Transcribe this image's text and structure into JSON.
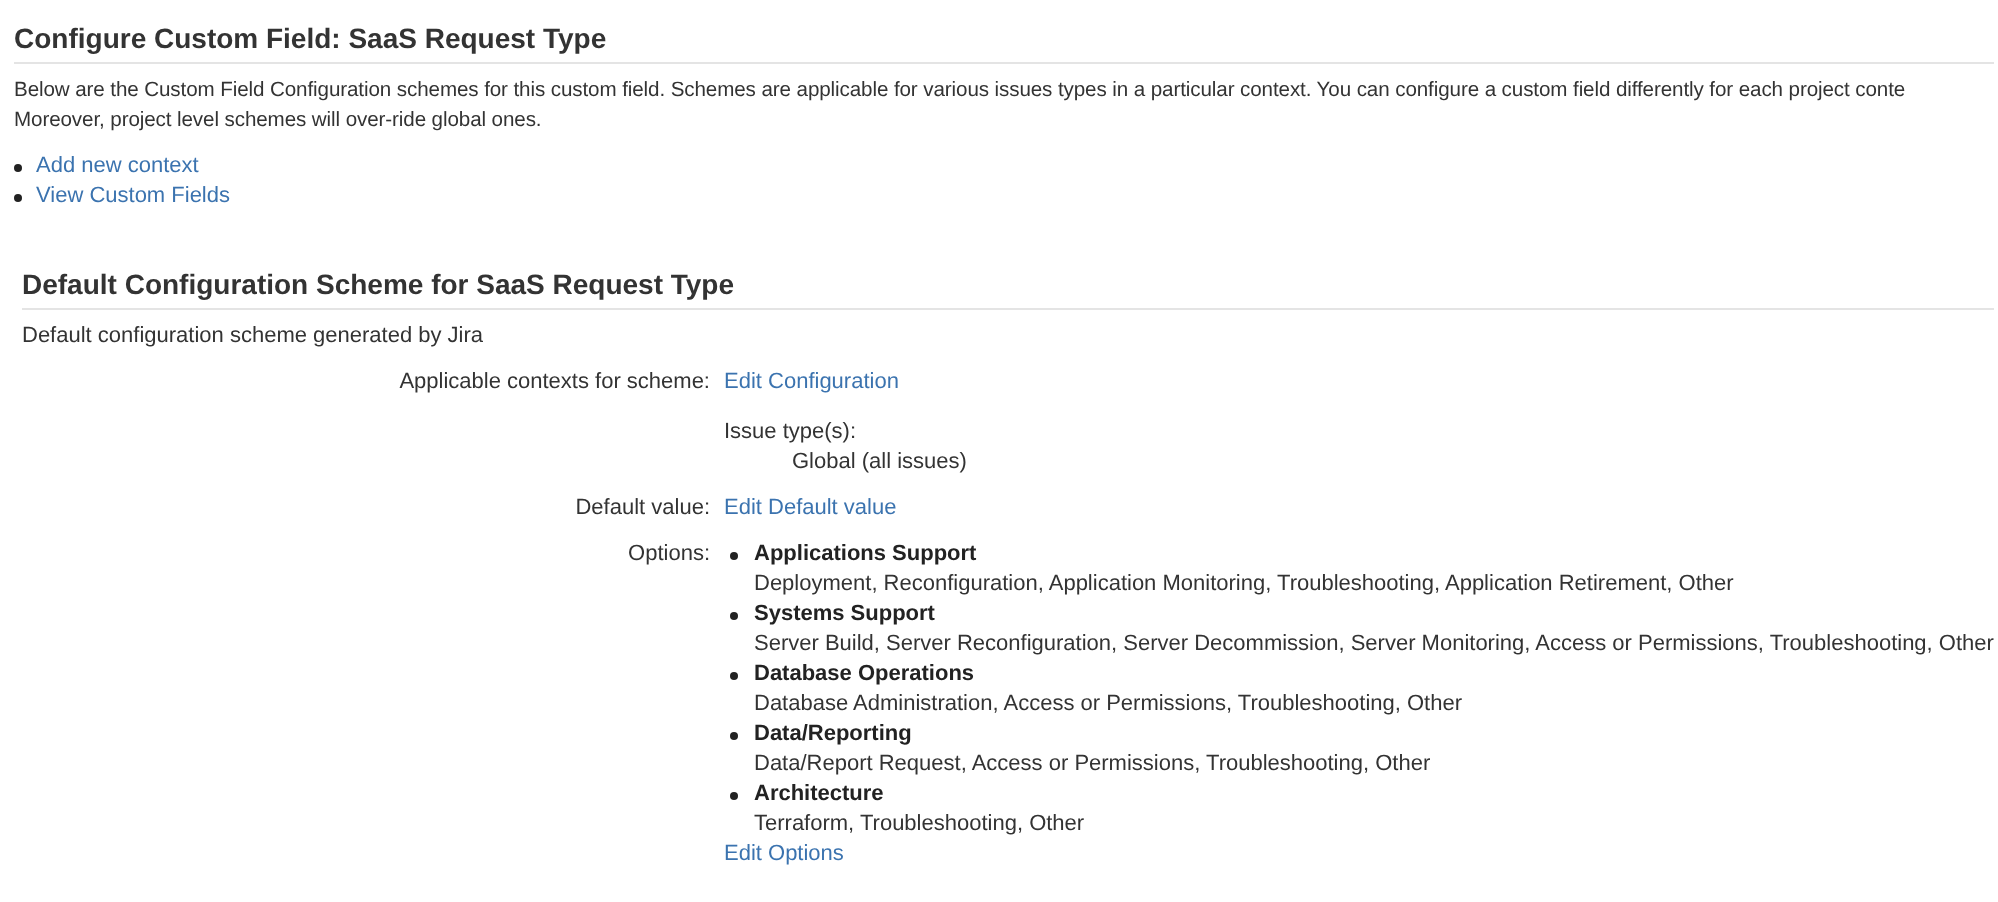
{
  "page_title": "Configure Custom Field: SaaS Request Type",
  "description_lines": [
    "Below are the Custom Field Configuration schemes for this custom field. Schemes are applicable for various issues types in a particular context. You can configure a custom field differently for each project conte",
    "Moreover, project level schemes will over-ride global ones."
  ],
  "links": [
    "Add new context",
    "View Custom Fields"
  ],
  "scheme": {
    "title": "Default Configuration Scheme for SaaS Request Type",
    "description": "Default configuration scheme generated by Jira",
    "contexts_label": "Applicable contexts for scheme:",
    "contexts_link": "Edit Configuration",
    "issue_types_label": "Issue type(s):",
    "issue_types_value": "Global (all issues)",
    "default_label": "Default value:",
    "default_link": "Edit Default value",
    "options_label": "Options:",
    "options": [
      {
        "name": "Applications Support",
        "children": "Deployment, Reconfiguration, Application Monitoring, Troubleshooting, Application Retirement, Other"
      },
      {
        "name": "Systems Support",
        "children": "Server Build, Server Reconfiguration, Server Decommission, Server Monitoring, Access or Permissions, Troubleshooting, Other"
      },
      {
        "name": "Database Operations",
        "children": "Database Administration, Access or Permissions, Troubleshooting, Other"
      },
      {
        "name": "Data/Reporting",
        "children": "Data/Report Request, Access or Permissions, Troubleshooting, Other"
      },
      {
        "name": "Architecture",
        "children": "Terraform, Troubleshooting, Other"
      }
    ],
    "options_link": "Edit Options"
  }
}
